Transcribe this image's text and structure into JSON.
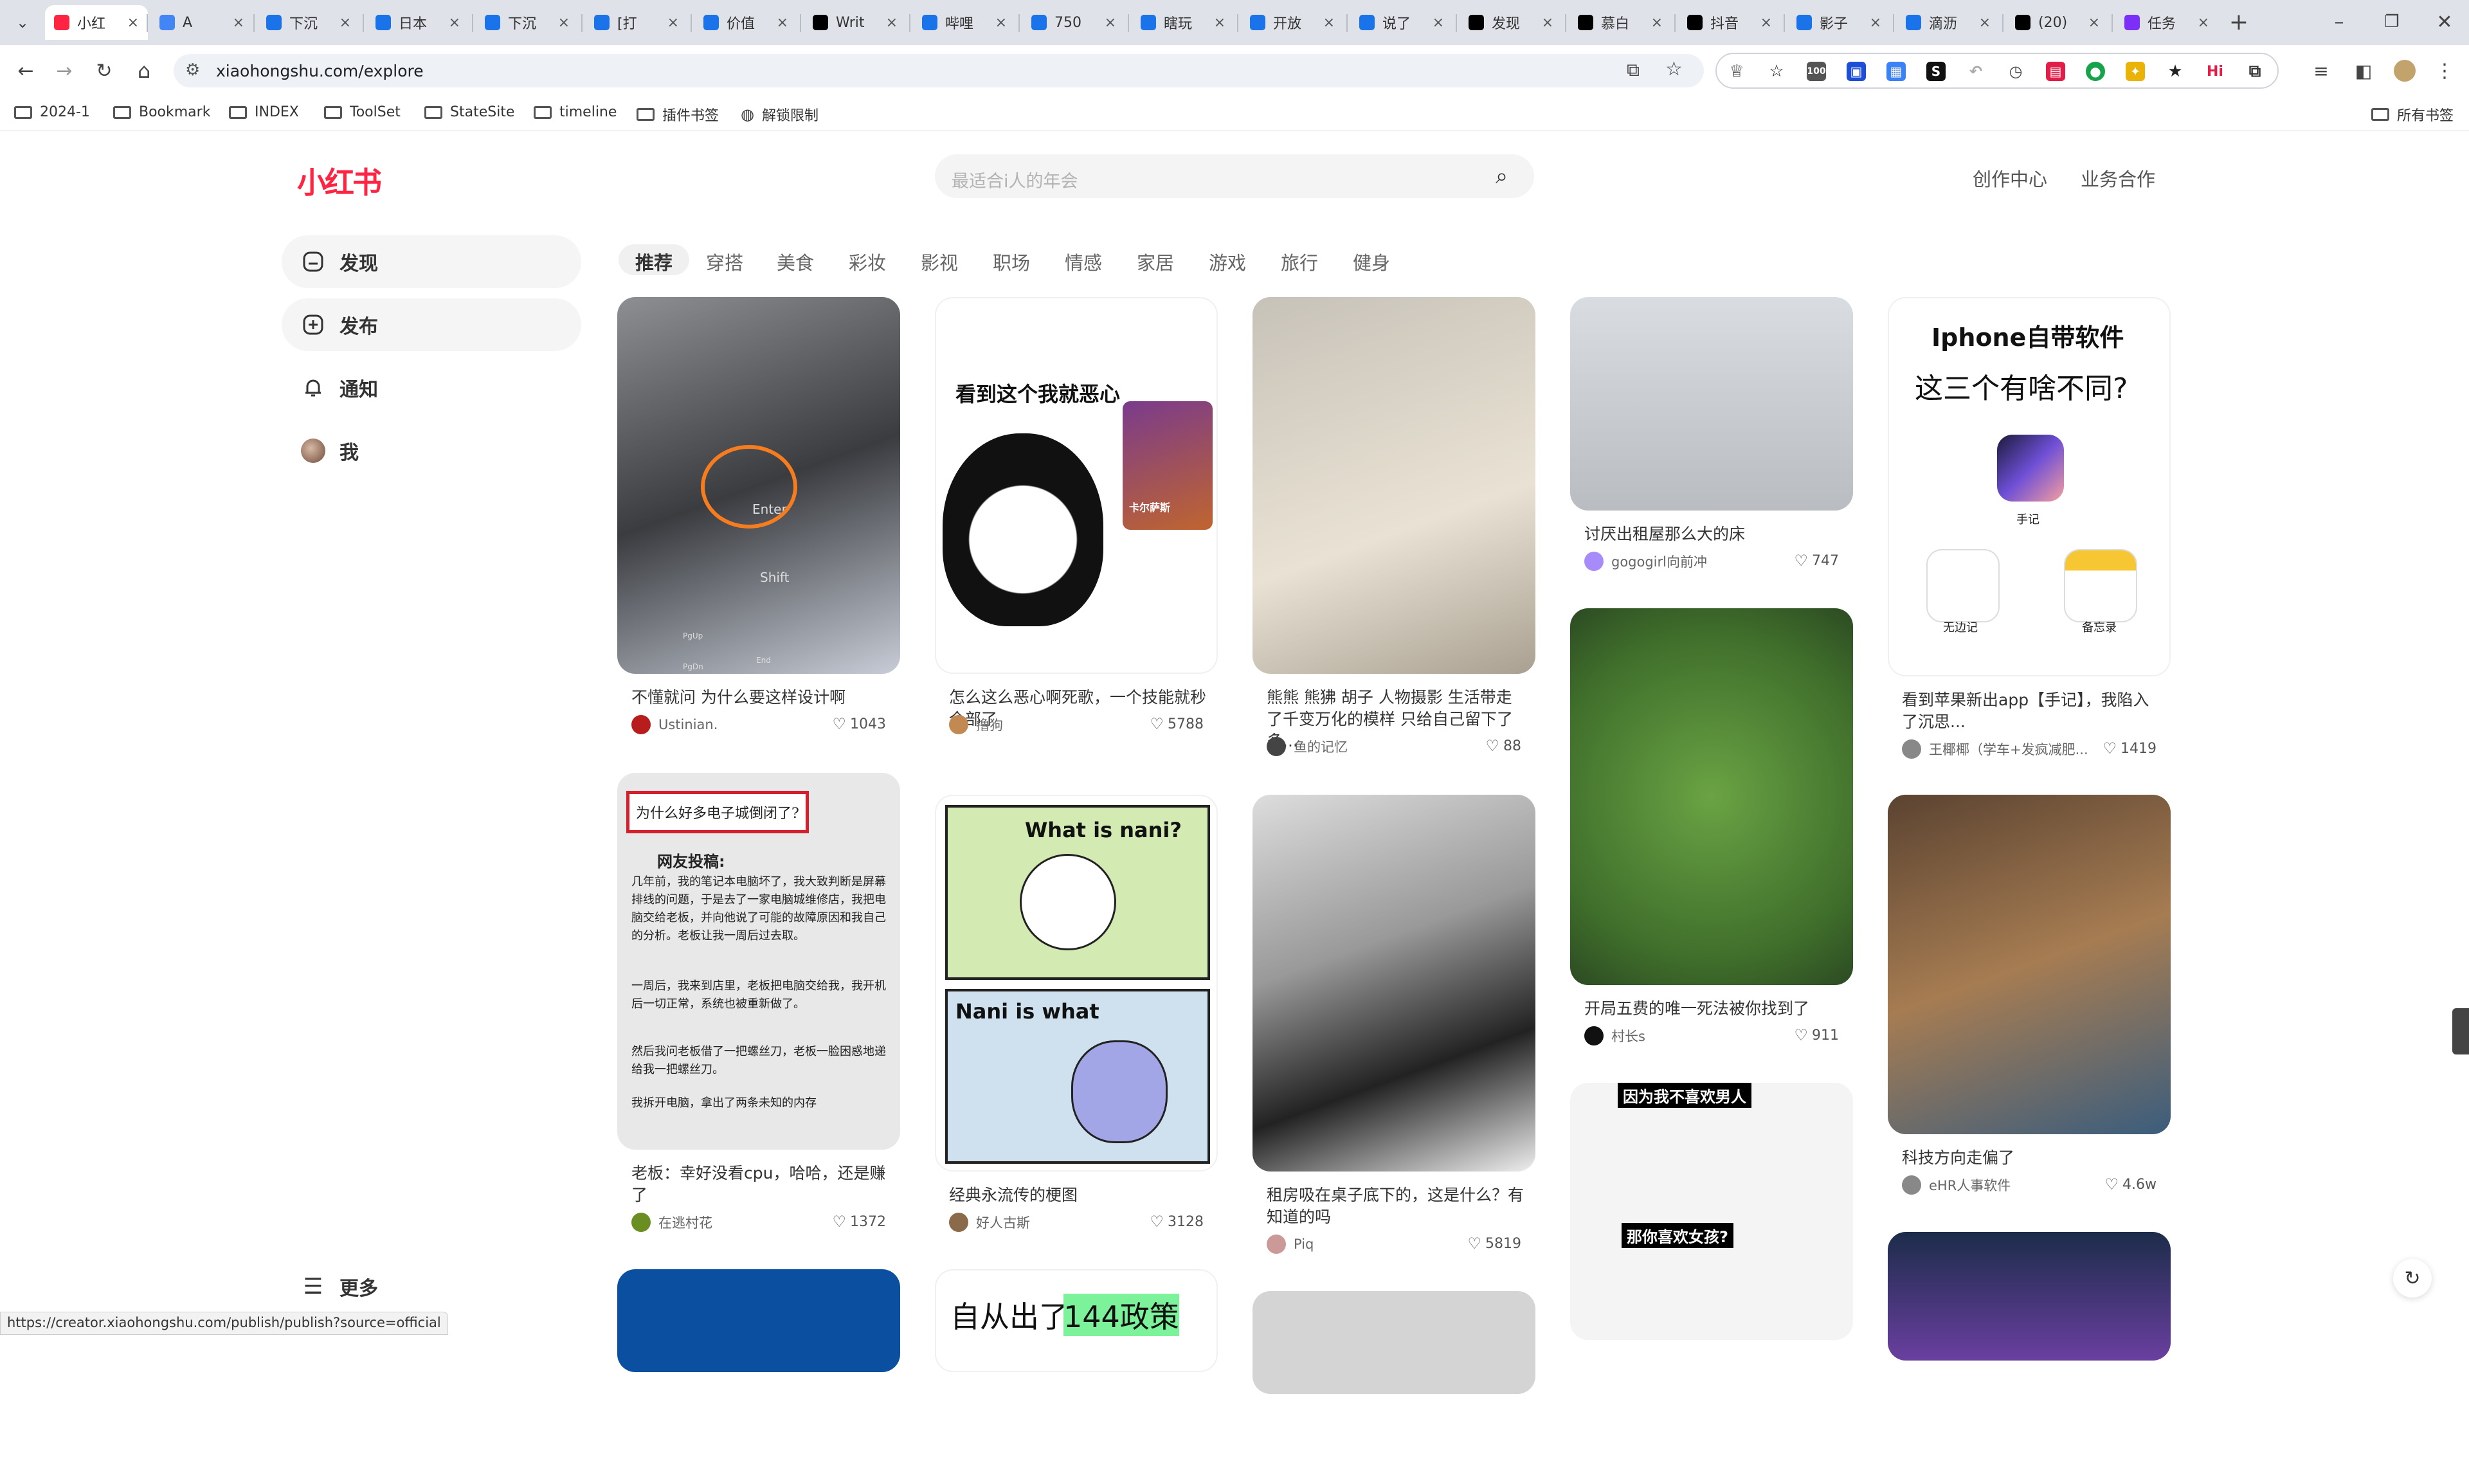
{
  "browser": {
    "tabs": [
      {
        "label": "小红",
        "color": "#ff2442",
        "active": true
      },
      {
        "label": "A",
        "color": "#4285f4"
      },
      {
        "label": "下沉",
        "color": "#1a73e8"
      },
      {
        "label": "日本",
        "color": "#1a73e8"
      },
      {
        "label": "下沉",
        "color": "#1a73e8"
      },
      {
        "label": "[打",
        "color": "#1a73e8"
      },
      {
        "label": "价值",
        "color": "#1a73e8"
      },
      {
        "label": "Writ",
        "color": "#000000"
      },
      {
        "label": "哔哩",
        "color": "#1a73e8"
      },
      {
        "label": "750",
        "color": "#1a73e8"
      },
      {
        "label": "瞎玩",
        "color": "#1a73e8"
      },
      {
        "label": "开放",
        "color": "#1a73e8"
      },
      {
        "label": "说了",
        "color": "#1a73e8"
      },
      {
        "label": "发现",
        "color": "#000000"
      },
      {
        "label": "慕白",
        "color": "#000000"
      },
      {
        "label": "抖音",
        "color": "#000000"
      },
      {
        "label": "影子",
        "color": "#1a73e8"
      },
      {
        "label": "滴沥",
        "color": "#1a73e8"
      },
      {
        "label": "(20)",
        "color": "#000000"
      },
      {
        "label": "任务",
        "color": "#7b2ff7"
      }
    ],
    "new_tab": "+",
    "url": "xiaohongshu.com/explore",
    "bookmarks": [
      "2024-1",
      "Bookmark",
      "INDEX",
      "ToolSet",
      "StateSite",
      "timeline",
      "插件书签",
      "解锁限制"
    ],
    "all_bookmarks": "所有书签",
    "ext_badge": "100",
    "ext_hi": "Hi",
    "status_url": "https://creator.xiaohongshu.com/publish/publish?source=official"
  },
  "site": {
    "logo": "小红书",
    "search_placeholder": "最适合i人的年会",
    "links": [
      "创作中心",
      "业务合作"
    ],
    "nav": [
      "发现",
      "发布",
      "通知",
      "我"
    ],
    "more": "更多",
    "channels": [
      "推荐",
      "穿搭",
      "美食",
      "彩妆",
      "影视",
      "职场",
      "情感",
      "家居",
      "游戏",
      "旅行",
      "健身"
    ]
  },
  "cards": [
    {
      "title": "不懂就问 为什么要这样设计啊",
      "author": "Ustinian.",
      "likes": "1043",
      "img_text": [
        "Enter",
        "Shift",
        "PgUp",
        "End",
        "PgDn"
      ]
    },
    {
      "title": "老板：幸好没看cpu，哈哈，还是赚了",
      "author": "在逃村花",
      "likes": "1372",
      "img_text": [
        "为什么好多电子城倒闭了?",
        "网友投稿:",
        "几年前，我的笔记本电脑坏了，我大致判断是屏幕排线的问题，于是去了一家电脑城维修店，我把电脑交给老板，并向他说了可能的故障原因和我自己的分析。老板让我一周后过去取。",
        "一周后，我来到店里，老板把电脑交给我，我开机后一切正常，系统也被重新做了。",
        "然后我问老板借了一把螺丝刀，老板一脸困惑地递给我一把螺丝刀。",
        "我拆开电脑，拿出了两条未知的内存"
      ]
    },
    {
      "title": "怎么这么恶心啊死歌，一个技能就秒全部了",
      "author": "撸狗",
      "likes": "5788",
      "img_text": [
        "看到这个我就恶心",
        "卡尔萨斯"
      ]
    },
    {
      "title": "经典永流传的梗图",
      "author": "好人古斯",
      "likes": "3128",
      "img_text": [
        "What is nani?",
        "Nani is what"
      ]
    },
    {
      "title": "熊熊 熊狒 胡子 人物摄影 生活带走了千变万化的模样 只给自己留下了多...",
      "author": "鱼的记忆",
      "likes": "88"
    },
    {
      "title": "租房吸在桌子底下的，这是什么？有知道的吗",
      "author": "Piq",
      "likes": "5819"
    },
    {
      "title": "讨厌出租屋那么大的床",
      "author": "gogogirl向前冲",
      "likes": "747"
    },
    {
      "title": "开局五费的唯一死法被你找到了",
      "author": "村长s",
      "likes": "911"
    },
    {
      "title": "",
      "author": "",
      "likes": "",
      "img_text": [
        "因为我不喜欢男人",
        "那你喜欢女孩?"
      ]
    },
    {
      "title": "看到苹果新出app【手记】，我陷入了沉思...",
      "author": "王椰椰（学车+发疯减肥...",
      "likes": "1419",
      "img_text": [
        "Iphone自带软件",
        "这三个有啥不同?",
        "手记",
        "无边记",
        "备忘录"
      ]
    },
    {
      "title": "科技方向走偏了",
      "author": "eHR人事软件",
      "likes": "4.6w"
    },
    {
      "title": "",
      "author": "",
      "likes": ""
    },
    {
      "title": "",
      "author": "",
      "likes": "",
      "img_text": [
        "自从出了",
        "144政策"
      ]
    },
    {
      "title": "",
      "author": "",
      "likes": ""
    },
    {
      "title": "",
      "author": "",
      "likes": ""
    }
  ],
  "colors": {
    "brand": "#ff2442",
    "tab_bg": "#dfe3e9"
  }
}
